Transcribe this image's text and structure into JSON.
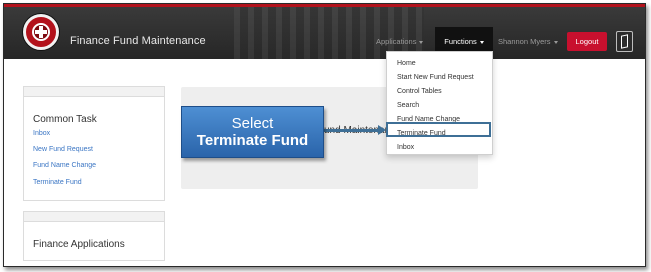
{
  "header": {
    "title": "Finance Fund Maintenance",
    "nav": [
      {
        "label": "Applications"
      },
      {
        "label": "Functions"
      },
      {
        "label": "Shannon Myers"
      }
    ],
    "logout_label": "Logout",
    "logo_icon": "university-seal-icon",
    "util_icon": "document-icon",
    "colors": {
      "bar": "#262626",
      "accent": "#b3121c",
      "logout": "#c8102e"
    }
  },
  "functions_menu": {
    "items": [
      {
        "label": "Home"
      },
      {
        "label": "Start New Fund Request"
      },
      {
        "label": "Control Tables"
      },
      {
        "label": "Search"
      },
      {
        "label": "Fund Name Change"
      },
      {
        "label": "Terminate Fund"
      },
      {
        "label": "Inbox"
      }
    ],
    "highlighted": "Terminate Fund"
  },
  "common_task": {
    "title": "Common Task",
    "links": [
      {
        "label": "Inbox"
      },
      {
        "label": "New Fund Request"
      },
      {
        "label": "Fund Name Change"
      },
      {
        "label": "Terminate Fund"
      }
    ]
  },
  "finance_apps": {
    "title": "Finance Applications"
  },
  "welcome": {
    "text": "und Maintenance"
  },
  "callout": {
    "line1": "Select",
    "line2": "Terminate Fund"
  }
}
